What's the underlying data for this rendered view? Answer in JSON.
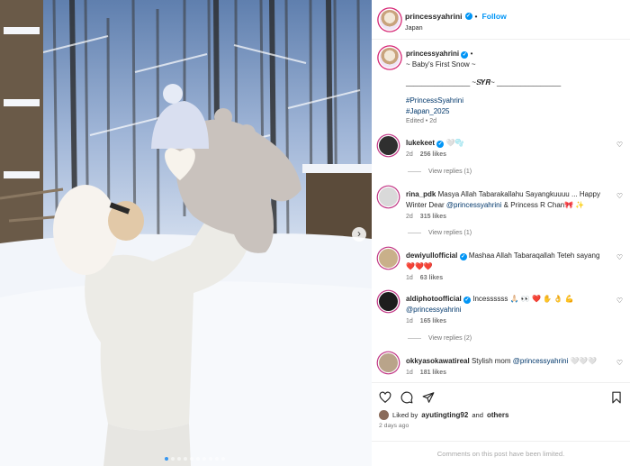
{
  "post": {
    "username": "princessyahrini",
    "follow_label": "Follow",
    "separator": "•",
    "location": "Japan",
    "caption_lines": [
      "~ Baby's First Snow ~",
      "________________ ~𝑺𝒀𝑹~ ________________"
    ],
    "hashtags": [
      "#PrincessSyahrini",
      "#Japan_2025"
    ],
    "edited": "Edited • 2d",
    "carousel_count": 10,
    "carousel_active": 1
  },
  "comments": [
    {
      "username": "lukekeet",
      "verified": true,
      "text": "🤍🫧",
      "time": "2d",
      "likes": "256 likes",
      "replies": "View replies (1)"
    },
    {
      "username": "rina_pdk",
      "verified": false,
      "text": "Masya Allah Tabarakallahu Sayangkuuuu ... Happy Winter Dear",
      "mention": "@princessyahrini",
      "text_after": "& Princess R Chan🎀 ✨",
      "time": "2d",
      "likes": "315 likes",
      "replies": "View replies (1)"
    },
    {
      "username": "dewiyullofficial",
      "verified": true,
      "text": "Mashaa Allah Tabaraqallah Teteh sayang ❤️❤️❤️",
      "time": "1d",
      "likes": "63 likes",
      "replies": ""
    },
    {
      "username": "aldiphotoofficial",
      "verified": true,
      "text": "Incessssss 🙏🏻 👀 ❤️ ✋ 👌 💪",
      "mention": "@princessyahrini",
      "time": "1d",
      "likes": "165 likes",
      "replies": "View replies (2)"
    },
    {
      "username": "okkyasokawatireal",
      "verified": false,
      "text": "Stylish mom",
      "mention": "@princessyahrini",
      "text_after": "🤍🤍🤍",
      "time": "1d",
      "likes": "181 likes",
      "replies": ""
    }
  ],
  "footer": {
    "liked_prefix": "Liked by",
    "liked_user": "ayutingting92",
    "liked_and": "and",
    "liked_others": "others",
    "time_ago": "2 days ago",
    "limited_text": "Comments on this post have been limited."
  },
  "icons": {
    "verified": "verified-badge-icon",
    "heart": "heart-icon",
    "comment": "comment-icon",
    "share": "share-icon",
    "save": "bookmark-icon",
    "next": "chevron-right-icon"
  },
  "colors": {
    "accent_blue": "#0095f6",
    "link_blue": "#00376b",
    "meta_gray": "#737373"
  }
}
